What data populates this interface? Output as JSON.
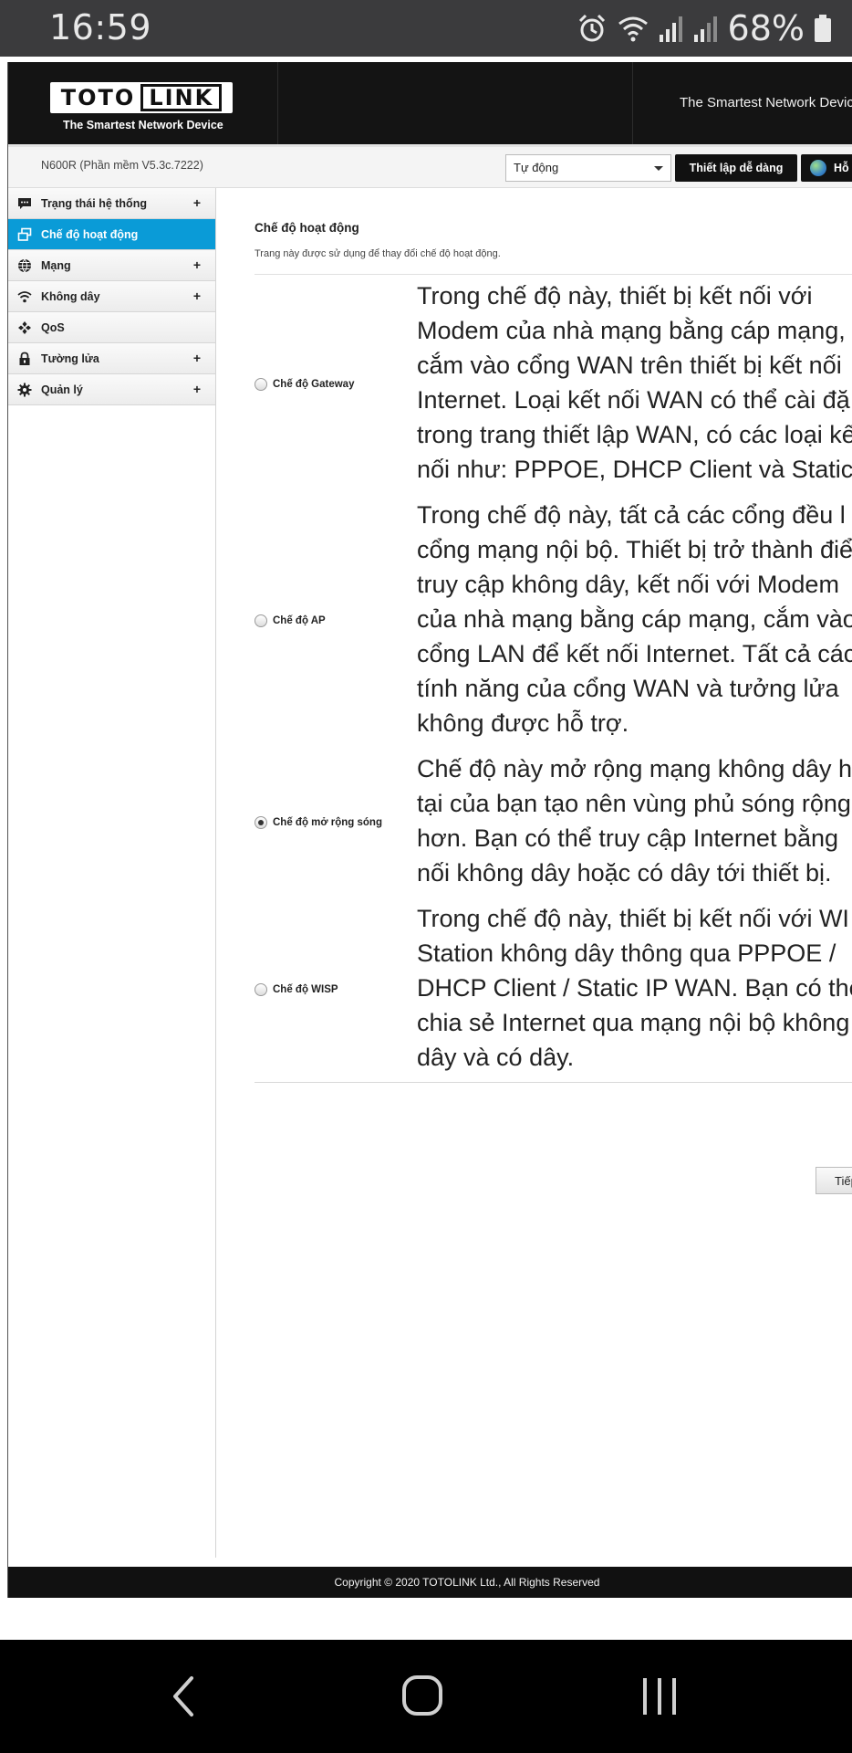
{
  "status_bar": {
    "time": "16:59",
    "battery": "68%"
  },
  "header": {
    "logo_left": "TOTO",
    "logo_right": "LINK",
    "tagline": "The Smartest Network Device",
    "right_tagline": "The Smartest Network Device"
  },
  "toolbar": {
    "model": "N600R (Phần mềm V5.3c.7222)",
    "language": "Tự động",
    "easy_setup": "Thiết lập dễ dàng",
    "help": "Hỗ"
  },
  "sidebar": {
    "items": [
      {
        "label": "Trạng thái hệ thống",
        "icon": "chat-icon",
        "expand": "+"
      },
      {
        "label": "Chế độ hoạt động",
        "icon": "windows-icon",
        "expand": ""
      },
      {
        "label": "Mạng",
        "icon": "globe-icon",
        "expand": "+"
      },
      {
        "label": "Không dây",
        "icon": "wifi-icon",
        "expand": "+"
      },
      {
        "label": "QoS",
        "icon": "qos-icon",
        "expand": ""
      },
      {
        "label": "Tường lửa",
        "icon": "lock-icon",
        "expand": "+"
      },
      {
        "label": "Quản lý",
        "icon": "gear-icon",
        "expand": "+"
      }
    ],
    "active_index": 1
  },
  "main": {
    "title": "Chế độ hoạt động",
    "description": "Trang này được sử dụng để thay đổi chế độ hoạt động.",
    "modes": [
      {
        "label": "Chế độ Gateway",
        "checked": false,
        "lines": [
          "Trong chế độ này, thiết bị kết nối với",
          "Modem của nhà mạng bằng cáp mạng,",
          "cắm vào cổng WAN trên thiết bị kết nối",
          "Internet. Loại kết nối WAN có thể cài đặ",
          "trong trang thiết lập WAN, có các loại kế",
          "nối như: PPPOE, DHCP Client và Static"
        ]
      },
      {
        "label": "Chế độ AP",
        "checked": false,
        "lines": [
          "Trong chế độ này, tất cả các cổng đều l",
          "cổng mạng nội bộ. Thiết bị trở thành điể",
          "truy cập không dây, kết nối với Modem",
          "của nhà mạng bằng cáp mạng, cắm vào",
          "cổng LAN để kết nối Internet. Tất cả các",
          "tính năng của cổng WAN và tưởng lửa",
          "không được hỗ trợ."
        ]
      },
      {
        "label": "Chế độ mở rộng sóng",
        "checked": true,
        "lines": [
          "Chế độ này mở rộng mạng không dây hi",
          "tại của bạn tạo nên vùng phủ sóng rộng",
          "hơn. Bạn có thể truy cập Internet bằng",
          "nối không dây hoặc có dây tới thiết bị."
        ]
      },
      {
        "label": "Chế độ WISP",
        "checked": false,
        "lines": [
          "Trong chế độ này, thiết bị kết nối với WI",
          "Station không dây thông qua PPPOE /",
          "DHCP Client / Static IP WAN. Bạn có thể",
          "chia sẻ Internet qua mạng nội bộ không",
          "dây và có dây."
        ]
      }
    ],
    "next_button": "Tiếp"
  },
  "footer": {
    "copyright": "Copyright © 2020 TOTOLINK Ltd., All Rights Reserved"
  }
}
